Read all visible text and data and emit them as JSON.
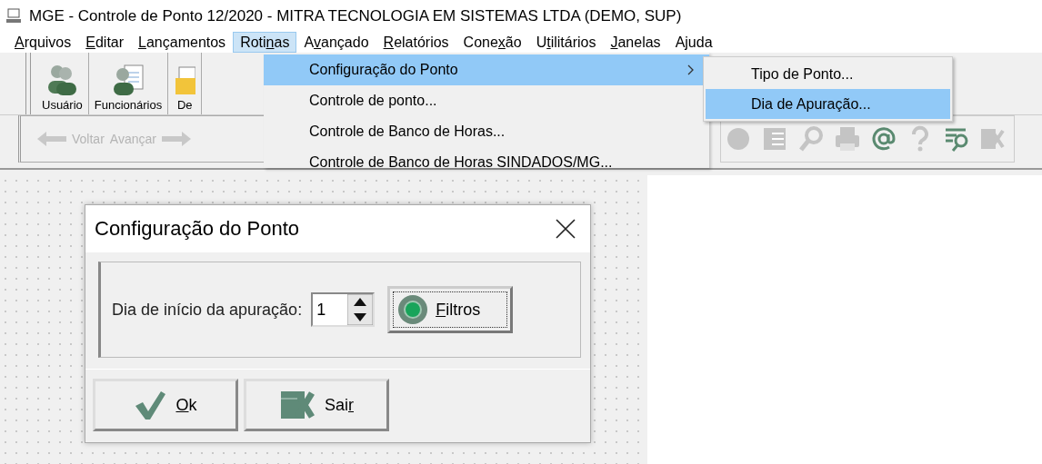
{
  "window": {
    "title": "MGE - Controle de Ponto 12/2020 - MITRA TECNOLOGIA EM SISTEMAS LTDA (DEMO, SUP)"
  },
  "menubar": [
    {
      "key": "A",
      "post": "rquivos",
      "selected": false
    },
    {
      "key": "E",
      "post": "ditar",
      "selected": false
    },
    {
      "key": "L",
      "post": "ançamentos",
      "selected": false
    },
    {
      "pre": "Roti",
      "key": "n",
      "post": "as",
      "selected": true
    },
    {
      "pre": "A",
      "key": "v",
      "post": "ançado",
      "selected": false
    },
    {
      "key": "R",
      "post": "elatórios",
      "selected": false
    },
    {
      "pre": "Cone",
      "key": "x",
      "post": "ão",
      "selected": false
    },
    {
      "pre": "U",
      "key": "t",
      "post": "ilitários",
      "selected": false
    },
    {
      "key": "J",
      "post": "anelas",
      "selected": false
    },
    {
      "pre": "A",
      "key": "j",
      "post": "uda",
      "selected": false
    }
  ],
  "toolbar": {
    "buttons": [
      {
        "label": "Usuário",
        "kind": "users"
      },
      {
        "label": "Funcionários",
        "kind": "employees"
      },
      {
        "label": "De",
        "kind": "folder"
      }
    ],
    "nav": [
      {
        "label": "Voltar",
        "kind": "back",
        "disabled": true
      },
      {
        "label": "Avançar",
        "kind": "forward",
        "disabled": true
      }
    ],
    "icons": [
      {
        "kind": "round",
        "disabled": true
      },
      {
        "kind": "list",
        "disabled": true
      },
      {
        "kind": "search",
        "disabled": true
      },
      {
        "kind": "print",
        "disabled": true
      },
      {
        "kind": "email",
        "disabled": false
      },
      {
        "kind": "help",
        "disabled": true
      },
      {
        "kind": "find",
        "disabled": false
      },
      {
        "kind": "exit",
        "disabled": true
      }
    ]
  },
  "menu": {
    "items": [
      {
        "label": "Configuração do Ponto",
        "selected": true,
        "submenu": true
      },
      {
        "label": "Controle de ponto...",
        "selected": false,
        "submenu": false
      },
      {
        "label": "Controle de Banco de Horas...",
        "selected": false,
        "submenu": false
      },
      {
        "label": "Controle de Banco de Horas SINDADOS/MG...",
        "selected": false,
        "submenu": false
      }
    ]
  },
  "submenu": {
    "items": [
      {
        "label": "Tipo de Ponto...",
        "selected": false
      },
      {
        "label": "Dia de Apuração...",
        "selected": true
      }
    ]
  },
  "dialog": {
    "title": "Configuração do Ponto",
    "field_label": "Dia de início da apuração:",
    "value": "1",
    "filter_button": {
      "key": "F",
      "post": "iltros"
    },
    "buttons": [
      {
        "key": "O",
        "post": "k",
        "kind": "ok"
      },
      {
        "pre": "Sai",
        "key": "r",
        "kind": "exit"
      }
    ]
  }
}
